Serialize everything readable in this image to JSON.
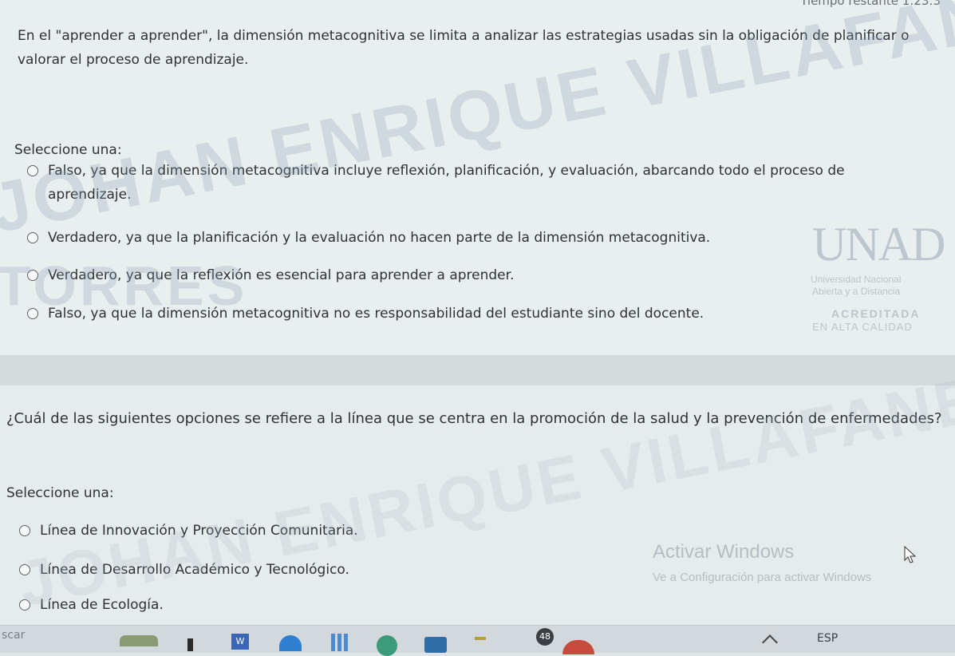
{
  "timer": {
    "label": "Tiempo restante 1:23:3"
  },
  "question1": {
    "text": "En el \"aprender a aprender\", la dimensión metacognitiva se limita a analizar las estrategias usadas sin la obligación de planificar o valorar el proceso de aprendizaje.",
    "select_label": "Seleccione una:",
    "options": [
      "Falso, ya que la dimensión metacognitiva incluye reflexión, planificación, y evaluación, abarcando todo el proceso de aprendizaje.",
      "Verdadero, ya que la planificación y la evaluación no hacen parte de la dimensión metacognitiva.",
      "Verdadero, ya que la reflexión es esencial para aprender a aprender.",
      "Falso, ya que la dimensión metacognitiva no es responsabilidad del estudiante sino del docente."
    ]
  },
  "question2": {
    "text": "¿Cuál de las siguientes opciones se refiere a la línea que se centra en la promoción de la salud y la prevención de enfermedades?",
    "select_label": "Seleccione una:",
    "options": [
      "Línea de Innovación y Proyección Comunitaria.",
      "Línea de Desarrollo Académico y Tecnológico.",
      "Línea de Ecología."
    ]
  },
  "watermark": {
    "line1": "JOHAN ENRIQUE VILLAFANE",
    "line2": "TORRES",
    "line3": "JOHAN ENRIQUE VILLAFANE"
  },
  "unad_logo": {
    "title": "UNAD",
    "line1": "Universidad Nacional",
    "line2": "Abierta y a Distancia",
    "acreditada": "ACREDITADA",
    "alta_calidad": "EN ALTA CALIDAD"
  },
  "activate_windows": {
    "title": "Activar Windows",
    "subtitle": "Ve a Configuración para activar Windows"
  },
  "taskbar": {
    "search_fragment": "scar",
    "badge_count": "48",
    "language": "ESP"
  },
  "colors": {
    "background": "#e9eeef",
    "watermark": "#8ca0b4",
    "text": "#2e3236"
  }
}
